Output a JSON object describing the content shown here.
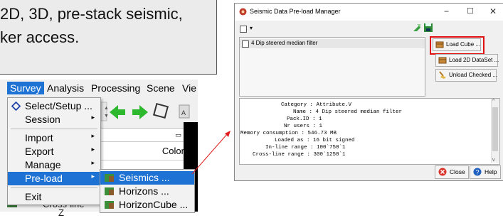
{
  "callout": {
    "line1": "2D, 3D, pre-stack seismic,",
    "line2": "ker access."
  },
  "app": {
    "menu": [
      "Survey",
      "Analysis",
      "Processing",
      "Scene",
      "Vie"
    ],
    "color_header": "Color",
    "dropdown": {
      "items": [
        {
          "label": "Select/Setup ...",
          "arrow": ""
        },
        {
          "label": "Session",
          "arrow": "▸"
        },
        {
          "label": "Import",
          "arrow": "▸"
        },
        {
          "label": "Export",
          "arrow": "▸"
        },
        {
          "label": "Manage",
          "arrow": "▸"
        },
        {
          "label": "Pre-load",
          "arrow": "▸"
        },
        {
          "label": "Exit",
          "arrow": ""
        }
      ]
    },
    "submenu": {
      "items": [
        "Seismics ...",
        "Horizons ...",
        "HorizonCube ..."
      ]
    },
    "behind_text": "Cross-line",
    "behind_text2": "Z"
  },
  "dialog": {
    "title": "Seismic Data Pre-load Manager",
    "controls": {
      "minimize": "−",
      "maximize": "☐",
      "close": "✕"
    },
    "list_items": [
      "4 Dip steered median filter"
    ],
    "buttons": {
      "load_cube": "Load Cube ...",
      "load_2d": "Load 2D DataSet ...",
      "unload": "Unload Checked ..."
    },
    "info": {
      "rows": [
        {
          "key": "Category",
          "value": "Attribute.V"
        },
        {
          "key": "Name",
          "value": "4 Dip steered median filter"
        },
        {
          "key": "Pack.ID",
          "value": "1"
        },
        {
          "key": "Nr users",
          "value": "1"
        },
        {
          "key": "Memory consumption",
          "value": "546.73 MB"
        },
        {
          "key": "Loaded as",
          "value": "16 bit signed"
        },
        {
          "key": "In-line range",
          "value": "100`750`1"
        },
        {
          "key": "Cross-line range",
          "value": "300`1250`1"
        }
      ]
    },
    "bottom": {
      "close": "Close",
      "help": "Help"
    },
    "colors": {
      "highlight_box": "#e01010",
      "menu_highlight": "#1e72d4"
    }
  }
}
